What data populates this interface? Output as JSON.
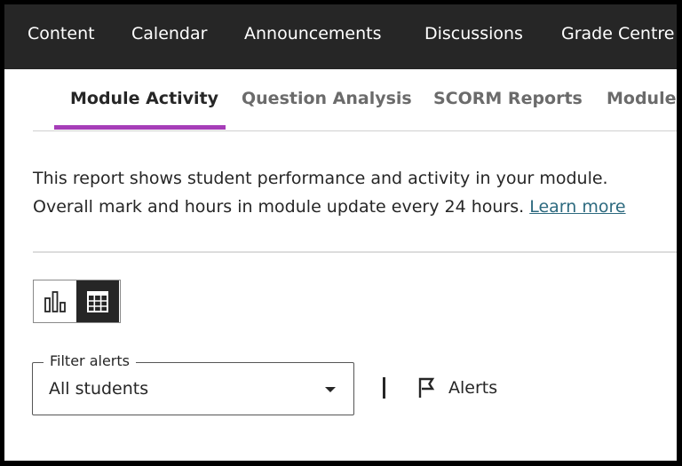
{
  "topnav": {
    "items": [
      "Content",
      "Calendar",
      "Announcements",
      "Discussions",
      "Grade Centre"
    ]
  },
  "tabs": {
    "items": [
      "Module Activity",
      "Question Analysis",
      "SCORM Reports",
      "Module"
    ],
    "active": "Module Activity"
  },
  "description": {
    "line1": "This report shows student performance and activity in your module.",
    "line2": "Overall mark and hours in module update every 24 hours.",
    "link": "Learn more"
  },
  "view_toggle": {
    "options": [
      "chart-view",
      "table-view"
    ],
    "selected": "table-view"
  },
  "filter": {
    "legend": "Filter alerts",
    "value": "All students"
  },
  "alerts": {
    "label": "Alerts",
    "icon": "flag-icon"
  },
  "colors": {
    "nav_bg": "#262626",
    "accent": "#a63db8",
    "link": "#2d6a7f"
  }
}
